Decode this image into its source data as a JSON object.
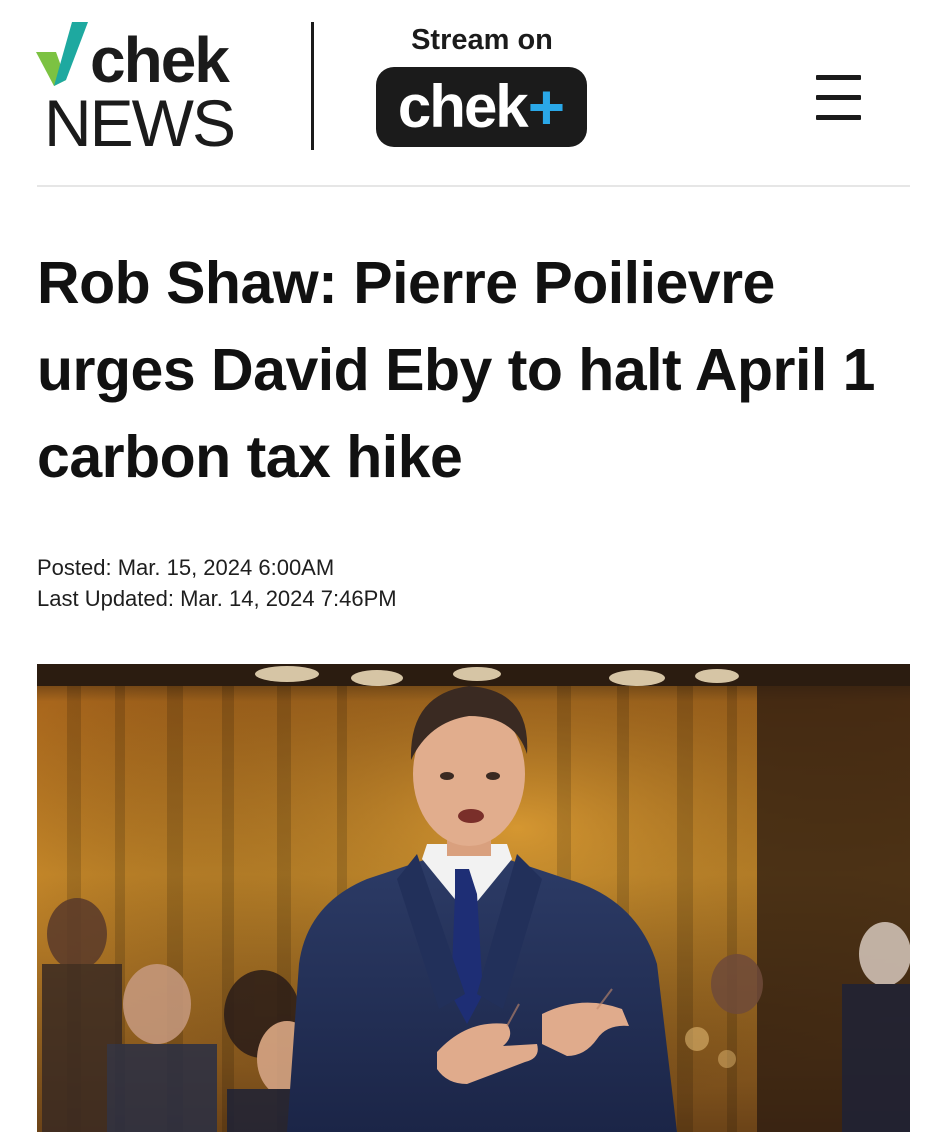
{
  "header": {
    "logo": {
      "top_text": "chek",
      "bottom_text": "NEWS"
    },
    "stream_label": "Stream on",
    "stream_brand": {
      "word": "chek",
      "plus": "+"
    },
    "menu_icon": "hamburger-menu-icon"
  },
  "article": {
    "headline": "Rob Shaw: Pierre Poilievre urges David Eby to halt April 1 carbon tax hike",
    "posted": "Posted: Mar. 15, 2024 6:00AM",
    "last_updated": "Last Updated: Mar. 14, 2024 7:46PM"
  },
  "colors": {
    "logo_green": "#7cc242",
    "logo_teal": "#1ea9a0",
    "brand_dark": "#1b1b1b",
    "plus_blue": "#2aa8e8",
    "rule": "#e6e6e6"
  }
}
